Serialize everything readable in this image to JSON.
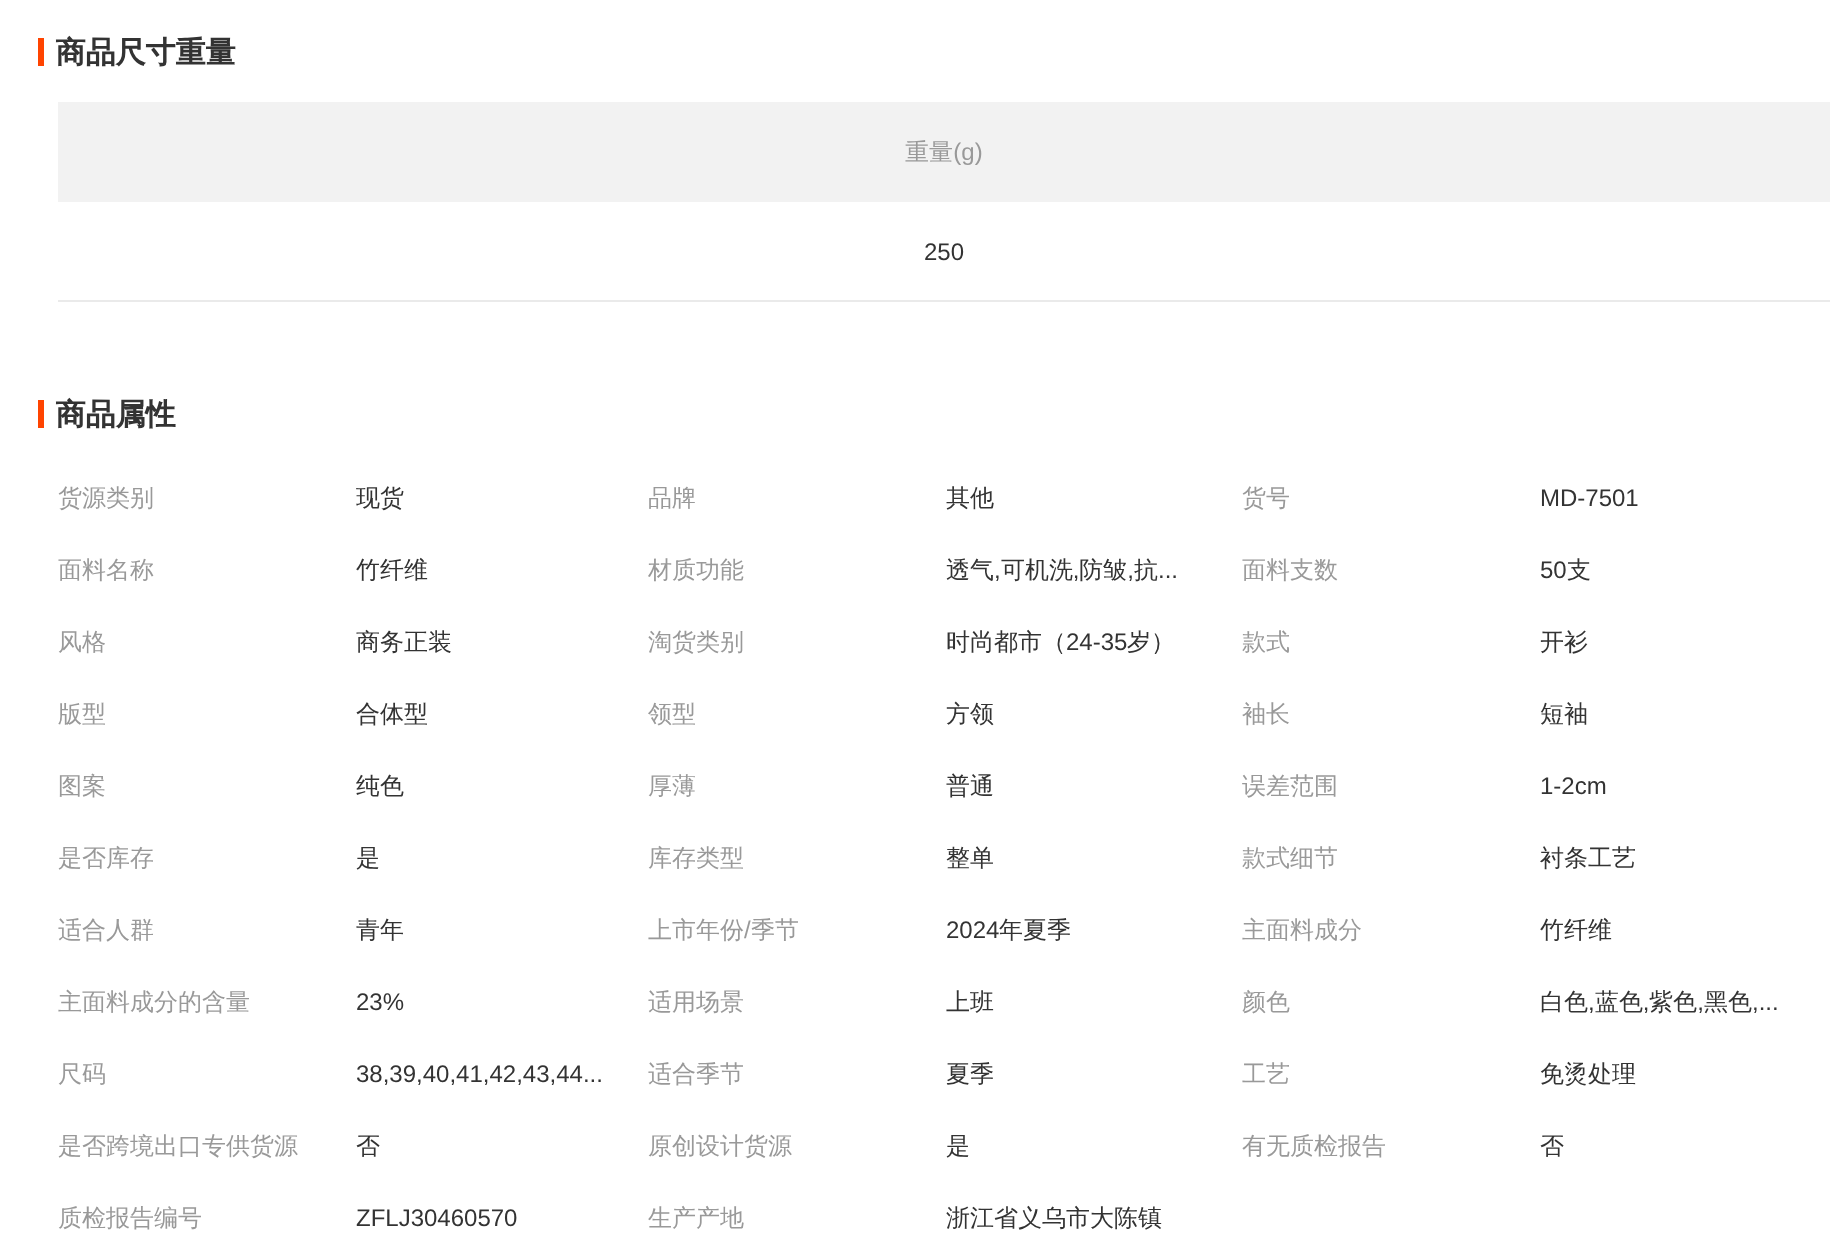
{
  "size_section": {
    "title": "商品尺寸重量",
    "columns": [
      "重量(g)"
    ],
    "rows": [
      [
        "250"
      ]
    ]
  },
  "attr_section": {
    "title": "商品属性",
    "rows": [
      [
        {
          "label": "货源类别",
          "value": "现货"
        },
        {
          "label": "品牌",
          "value": "其他"
        },
        {
          "label": "货号",
          "value": "MD-7501"
        }
      ],
      [
        {
          "label": "面料名称",
          "value": "竹纤维"
        },
        {
          "label": "材质功能",
          "value": "透气,可机洗,防皱,抗..."
        },
        {
          "label": "面料支数",
          "value": "50支"
        }
      ],
      [
        {
          "label": "风格",
          "value": "商务正装"
        },
        {
          "label": "淘货类别",
          "value": "时尚都市（24-35岁）"
        },
        {
          "label": "款式",
          "value": "开衫"
        }
      ],
      [
        {
          "label": "版型",
          "value": "合体型"
        },
        {
          "label": "领型",
          "value": "方领"
        },
        {
          "label": "袖长",
          "value": "短袖"
        }
      ],
      [
        {
          "label": "图案",
          "value": "纯色"
        },
        {
          "label": "厚薄",
          "value": "普通"
        },
        {
          "label": "误差范围",
          "value": "1-2cm"
        }
      ],
      [
        {
          "label": "是否库存",
          "value": "是"
        },
        {
          "label": "库存类型",
          "value": "整单"
        },
        {
          "label": "款式细节",
          "value": "衬条工艺"
        }
      ],
      [
        {
          "label": "适合人群",
          "value": "青年"
        },
        {
          "label": "上市年份/季节",
          "value": "2024年夏季"
        },
        {
          "label": "主面料成分",
          "value": "竹纤维"
        }
      ],
      [
        {
          "label": "主面料成分的含量",
          "value": "23%"
        },
        {
          "label": "适用场景",
          "value": "上班"
        },
        {
          "label": "颜色",
          "value": "白色,蓝色,紫色,黑色,..."
        }
      ],
      [
        {
          "label": "尺码",
          "value": "38,39,40,41,42,43,44..."
        },
        {
          "label": "适合季节",
          "value": "夏季"
        },
        {
          "label": "工艺",
          "value": "免烫处理"
        }
      ],
      [
        {
          "label": "是否跨境出口专供货源",
          "value": "否"
        },
        {
          "label": "原创设计货源",
          "value": "是"
        },
        {
          "label": "有无质检报告",
          "value": "否"
        }
      ],
      [
        {
          "label": "质检报告编号",
          "value": "ZFLJ30460570"
        },
        {
          "label": "生产产地",
          "value": "浙江省义乌市大陈镇"
        }
      ]
    ]
  }
}
